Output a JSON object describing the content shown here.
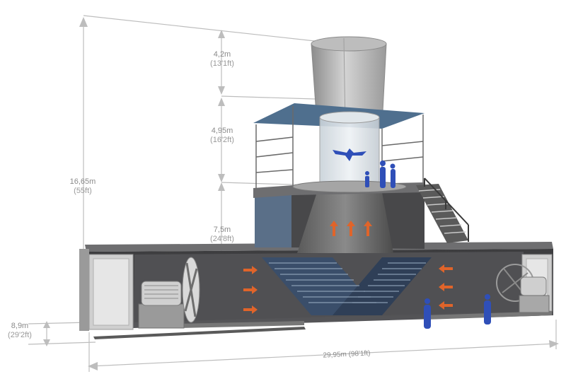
{
  "colors": {
    "background": "#ffffff",
    "dimension_line": "#b9b9b9",
    "dimension_text": "#8a8a8a",
    "steel_light": "#b9b9b9",
    "steel_mid": "#8e8e8e",
    "steel_dark": "#3f3f3f",
    "interior": "#4a4a4c",
    "glass": "#d7e2ea",
    "roof_blue": "#4f6f8e",
    "base_blue": "#5a6f88",
    "arrow_orange": "#e0642a",
    "figure_blue": "#2f4fb8"
  },
  "dimensions": {
    "diffuser": {
      "metric": "4,2m",
      "imperial": "(13'1ft)"
    },
    "flight_chamber": {
      "metric": "4,95m",
      "imperial": "(16'2ft)"
    },
    "plenum": {
      "metric": "7,5m",
      "imperial": "(24'8ft)"
    },
    "total_height": {
      "metric": "16,65m",
      "imperial": "(55ft)"
    },
    "below_ground": {
      "metric": "8,9m",
      "imperial": "(29'2ft)"
    },
    "total_length": {
      "label": "29,95m (98'1ft)"
    }
  },
  "icons": {
    "fan_left": "axial-fan-icon",
    "fan_right": "axial-fan-icon",
    "motor": "electric-motor-icon",
    "person": "person-silhouette-icon",
    "flyer": "skydiver-icon",
    "airflow": "airflow-arrow-icon"
  }
}
